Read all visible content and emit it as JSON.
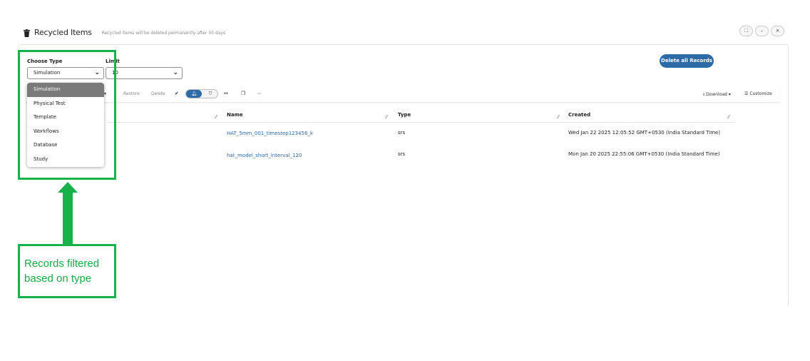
{
  "header": {
    "title": "Recycled Items",
    "subtitle": "Recycled items will be deleted permanently after 30 days",
    "window_buttons": [
      "⛶",
      "–",
      "×"
    ]
  },
  "filters": {
    "type_label": "Choose Type",
    "type_value": "Simulation",
    "limit_label": "Limit",
    "limit_value": "10"
  },
  "delete_all_label": "Delete all Records",
  "toolbar": {
    "restore": "Restore",
    "delete": "Delete",
    "download": "Download",
    "customize": "Customize"
  },
  "table": {
    "columns": [
      "Name",
      "Type",
      "Created"
    ],
    "rows": [
      {
        "name": "HAT_5mm_001_timestep123456_k",
        "type": "srs",
        "created": "Wed Jan 22 2025 12:05:52 GMT+0530 (India Standard Time)"
      },
      {
        "name": "hat_model_short_interval_120",
        "type": "srs",
        "created": "Mon Jan 20 2025 22:55:06 GMT+0530 (India Standard Time)"
      }
    ]
  },
  "dropdown": {
    "options": [
      "Simulation",
      "Physical Test",
      "Template",
      "Workflows",
      "Database",
      "Study"
    ],
    "selected_index": 0
  },
  "annotation": {
    "line1": "Records filtered",
    "line2": "based on type",
    "color": "#17b24a"
  },
  "colors": {
    "accent": "#2d6aa6",
    "annotation": "#17b24a"
  }
}
